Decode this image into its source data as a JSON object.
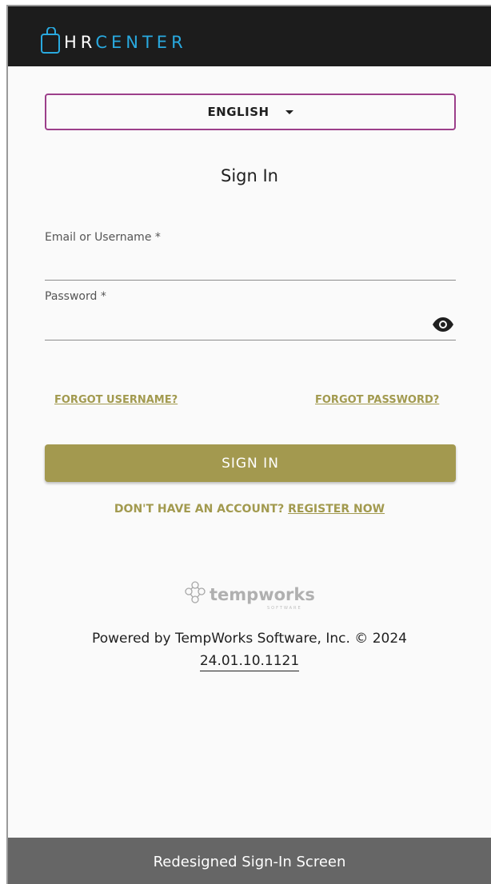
{
  "header": {
    "logo_hr": "HR",
    "logo_center": "CENTER",
    "logo_icon": "bag-icon"
  },
  "language": {
    "selected": "ENGLISH",
    "icon": "caret-down-icon"
  },
  "form": {
    "title": "Sign In",
    "email_label": "Email or Username *",
    "email_value": "",
    "password_label": "Password *",
    "password_value": "",
    "password_toggle_icon": "eye-icon"
  },
  "links": {
    "forgot_username": "FORGOT USERNAME?",
    "forgot_password": "FORGOT PASSWORD?"
  },
  "actions": {
    "sign_in": "SIGN IN",
    "no_account": "DON'T HAVE AN ACCOUNT?",
    "register": "REGISTER NOW"
  },
  "footer": {
    "brand_logo": "tempworks",
    "powered_by": "Powered by TempWorks Software, Inc. © 2024",
    "version": "24.01.10.1121"
  },
  "caption": "Redesigned Sign-In Screen",
  "colors": {
    "header_bg": "#1c1c1c",
    "brand_blue": "#29a9df",
    "accent_gold": "#a3994f",
    "select_border": "#9c3f8a",
    "caption_bg": "#666666"
  }
}
